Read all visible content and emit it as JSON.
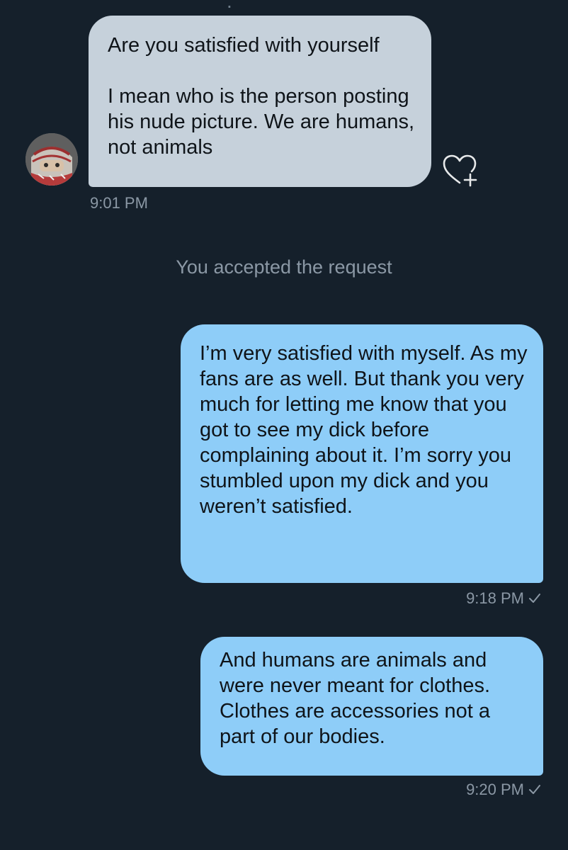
{
  "thread": {
    "incoming_message": {
      "text": "Are you satisfied with yourself\n\nI mean who is the person posting his nude picture.  We are humans, not animals",
      "time": "9:01 PM"
    },
    "system_notice": "You accepted the request",
    "outgoing_messages": [
      {
        "text": "I’m very satisfied with myself. As my fans are as well. But thank you very much for letting me know that you got to see my dick before complaining about it. I’m sorry you stumbled upon my dick and you weren’t satisfied.",
        "time": "9:18 PM"
      },
      {
        "text": "And humans are animals and were never meant for clothes. Clothes are accessories not a part of our bodies.",
        "time": "9:20 PM"
      }
    ]
  },
  "icons": {
    "avatar": "sender-avatar",
    "reaction": "heart-plus-icon",
    "read_receipt": "checkmark-icon"
  },
  "colors": {
    "background": "#15202b",
    "incoming_bubble": "#c6d1db",
    "outgoing_bubble": "#8ecdf8",
    "meta_text": "#8b98a5"
  }
}
